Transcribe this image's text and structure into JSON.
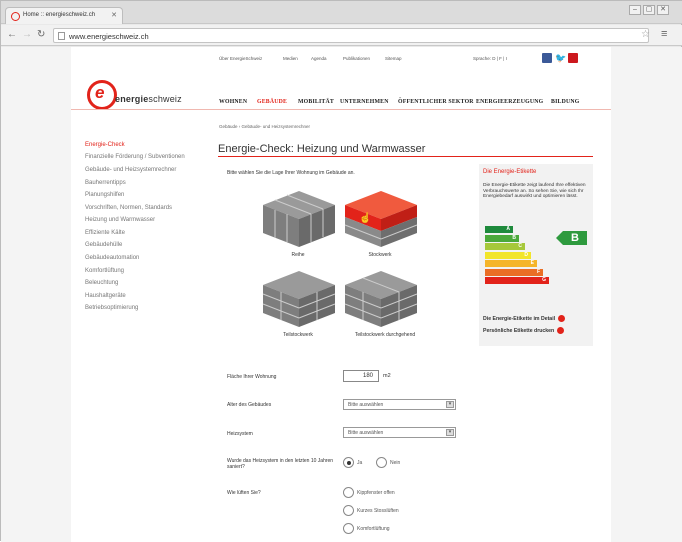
{
  "browser": {
    "tab_title": "Home :: energieschweiz.ch",
    "url": "www.energieschweiz.ch"
  },
  "site": {
    "toplinks": [
      "Über EnergieSchweiz",
      "Medien",
      "Agenda",
      "Publikationen",
      "Sitemap"
    ],
    "language": "Sprache: D | F | I",
    "logo_text_bold": "energie",
    "logo_text_light": "schweiz",
    "mainnav": [
      "WOHNEN",
      "GEBÄUDE",
      "MOBILITÄT",
      "UNTERNEHMEN",
      "ÖFFENTLICHER SEKTOR",
      "ENERGIEERZEUGUNG",
      "BILDUNG"
    ],
    "active_nav": "GEBÄUDE",
    "breadcrumb": "Gebäude › Gebäude- und Heizsystemrechner"
  },
  "sidenav": [
    "Energie-Check",
    "Finanzielle Förderung / Subventionen",
    "Gebäude- und Heizsystemrechner",
    "Bauherrentipps",
    "Planungshilfen",
    "Vorschriften, Normen, Standards",
    "Heizung und Warmwasser",
    "Effiziente Kälte",
    "Gebäudehülle",
    "Gebäudeautomation",
    "Komfortlüftung",
    "Beleuchtung",
    "Haushaltgeräte",
    "Betriebsoptimierung"
  ],
  "main": {
    "title": "Energie-Check: Heizung und Warmwasser",
    "intro": "Bitte wählen Sie die Lage Ihrer Wohnung im Gebäude an.",
    "positions": [
      "Reihe",
      "Stockwerk",
      "Teilstockwerk",
      "Teilstockwerk durchgehend"
    ],
    "selected_position": "Stockwerk",
    "area_label": "Fläche Ihrer Wohnung",
    "area_value": "180",
    "area_unit": "m2",
    "age_label": "Alter des Gebäudes",
    "age_value": "Bitte auswählen",
    "heating_label": "Heizsystem",
    "heating_value": "Bitte auswählen",
    "renovated_label": "Wurde das Heizsystem in den letzten 10 Jahren saniert?",
    "yes": "Ja",
    "no": "Nein",
    "ventilation_label": "Wie lüften Sie?",
    "vent_options": [
      "Kippfenster offen",
      "Kurzes Stosslüften",
      "Komfortlüftung"
    ]
  },
  "card": {
    "title": "Die Energie-Etikette",
    "text": "Die Energie-Etikette zeigt laufend Ihre effektiven Verbrauchswerte an. So sehen Sie, wie sich Ihr Energiebedarf auswirkt und optimieren lässt.",
    "classes": [
      "A",
      "B",
      "C",
      "D",
      "E",
      "F",
      "G"
    ],
    "class_colors": [
      "#1e8a3c",
      "#4aa83a",
      "#a6c83a",
      "#f2e52a",
      "#f5b52a",
      "#ea6e25",
      "#e2231a"
    ],
    "current_class": "B",
    "link1": "Die Energie-Etikette im Detail",
    "link2": "Persönliche Etikette drucken"
  }
}
